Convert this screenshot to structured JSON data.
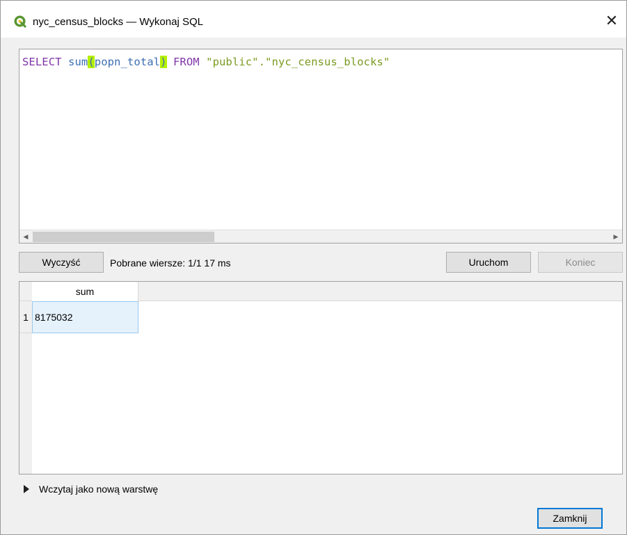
{
  "window": {
    "title": "nyc_census_blocks — Wykonaj SQL",
    "close_glyph": "✕"
  },
  "editor": {
    "tokens": {
      "kw_select": "SELECT",
      "fn_sum": "sum",
      "paren_open": "(",
      "column": "popn_total",
      "paren_close": ")",
      "kw_from": "FROM",
      "str_schema": "\"public\"",
      "dot": ".",
      "str_table": "\"nyc_census_blocks\""
    }
  },
  "toolbar": {
    "clear_label": "Wyczyść",
    "status": "Pobrane wiersze: 1/1  17 ms",
    "run_label": "Uruchom",
    "stop_label": "Koniec"
  },
  "results": {
    "columns": [
      "sum"
    ],
    "rows": [
      {
        "index": "1",
        "cells": [
          "8175032"
        ]
      }
    ]
  },
  "load_as_layer_label": "Wczytaj jako nową warstwę",
  "footer": {
    "close_label": "Zamknij"
  },
  "colors": {
    "keyword": "#7f34a8",
    "identifier": "#3b6fb3",
    "string": "#7a9a1f",
    "paren_highlight": "#b5f000",
    "selected_cell": "#e5f1fb",
    "focus_border": "#0078d7"
  },
  "icons": {
    "app": "qgis-logo-icon",
    "close": "close-icon",
    "scroll_left": "scroll-left-arrow-icon",
    "scroll_right": "scroll-right-arrow-icon",
    "expander": "triangle-right-icon"
  }
}
